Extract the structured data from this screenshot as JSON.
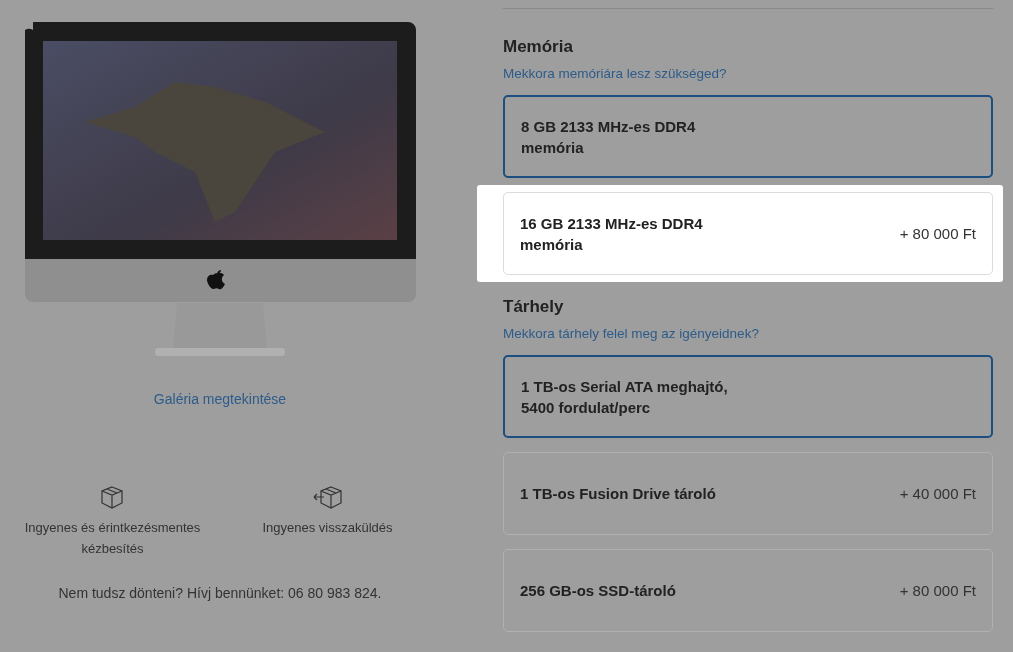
{
  "product": {
    "gallery_link": "Galéria megtekintése"
  },
  "perks": [
    {
      "kind": "delivery",
      "label": "Ingyenes és érintkezésmentes kézbesítés"
    },
    {
      "kind": "return",
      "label": "Ingyenes visszaküldés"
    }
  ],
  "help_text": "Nem tudsz dönteni? Hívj bennünket: 06 80 983 824.",
  "sections": [
    {
      "title": "Memória",
      "help_link": "Mekkora memóriára lesz szükséged?",
      "options": [
        {
          "label": "8 GB 2133 MHz-es DDR4\nmemória",
          "selected": true,
          "highlighted": false
        },
        {
          "label": "16 GB 2133 MHz-es DDR4\nmemória",
          "price": "+ 80 000 Ft",
          "selected": false,
          "highlighted": true
        }
      ]
    },
    {
      "title": "Tárhely",
      "help_link": "Mekkora tárhely felel meg az igényeidnek?",
      "options": [
        {
          "label": "1 TB-os Serial ATA meghajtó,\n5400 fordulat/perc",
          "selected": true,
          "highlighted": false
        },
        {
          "label": "1 TB-os Fusion Drive tároló",
          "price": "+ 40 000 Ft",
          "selected": false,
          "highlighted": false
        },
        {
          "label": "256 GB-os SSD-tároló",
          "price": "+ 80 000 Ft",
          "selected": false,
          "highlighted": false
        }
      ]
    }
  ]
}
